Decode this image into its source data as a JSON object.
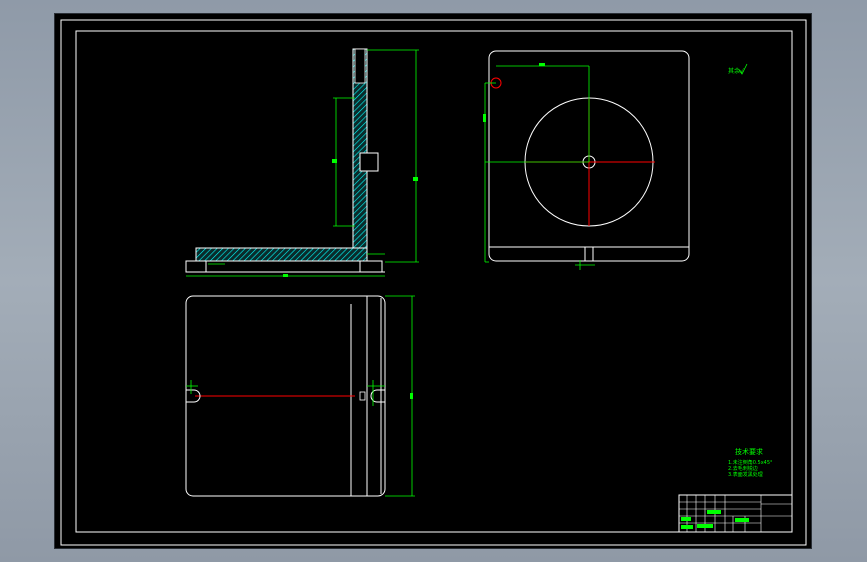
{
  "notes": {
    "title": "技术要求",
    "lines": [
      "1.未注倒角0.5x45°",
      "2.去毛刺锐边",
      "3.表面发黑处理"
    ]
  },
  "roughness": "其余√",
  "title_block": {
    "cells": [
      "",
      "",
      "",
      "",
      "",
      "",
      "",
      ""
    ]
  },
  "colors": {
    "background": "#000000",
    "frame": "#ffffff",
    "outline": "#ffffff",
    "dimension": "#00ff00",
    "hatch": "#00ffff",
    "centerline": "#ff0000"
  }
}
